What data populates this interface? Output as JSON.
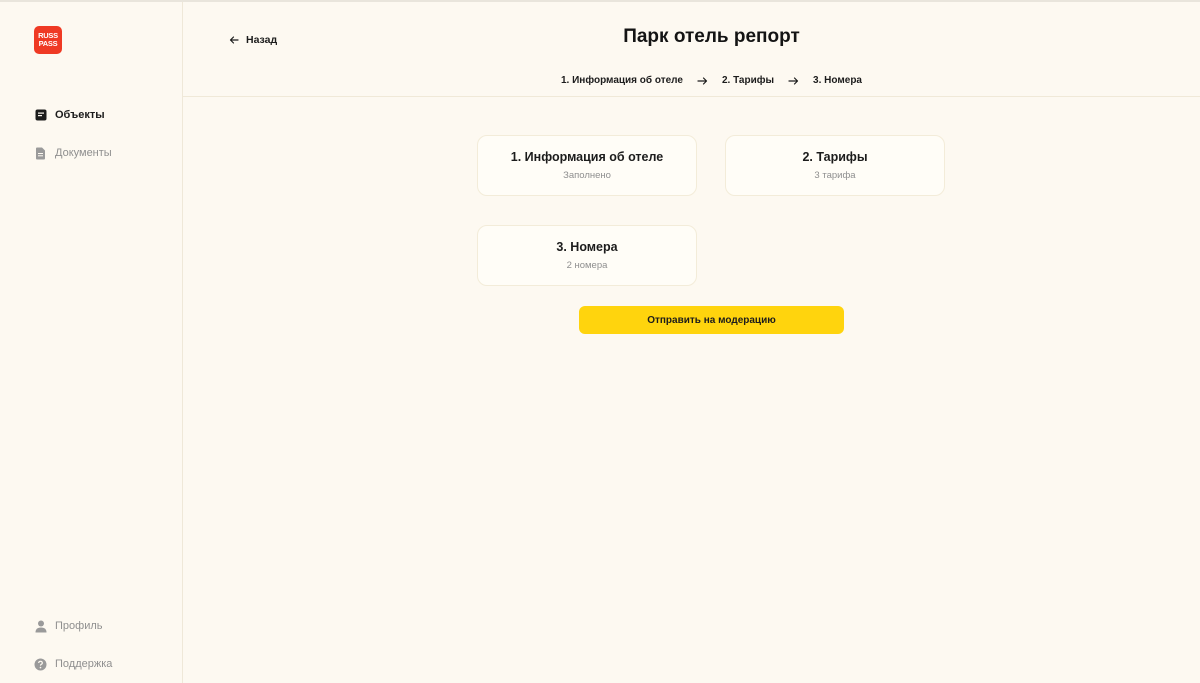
{
  "brand": {
    "logo_line1": "RUSS",
    "logo_line2": "PASS",
    "color": "#ef3a24"
  },
  "sidebar": {
    "items": [
      {
        "label": "Объекты",
        "icon": "objects-icon",
        "active": true
      },
      {
        "label": "Документы",
        "icon": "document-icon",
        "active": false
      }
    ],
    "bottom_items": [
      {
        "label": "Профиль",
        "icon": "user-icon"
      },
      {
        "label": "Поддержка",
        "icon": "help-icon"
      }
    ]
  },
  "header": {
    "back_label": "Назад",
    "title": "Парк отель репорт",
    "steps": [
      "1. Информация об отеле",
      "2. Тарифы",
      "3. Номера"
    ]
  },
  "cards": [
    {
      "title": "1. Информация об отеле",
      "subtitle": "Заполнено"
    },
    {
      "title": "2. Тарифы",
      "subtitle": "3 тарифа"
    },
    {
      "title": "3. Номера",
      "subtitle": "2 номера"
    }
  ],
  "actions": {
    "submit_label": "Отправить на модерацию",
    "accent": "#ffd40d"
  }
}
